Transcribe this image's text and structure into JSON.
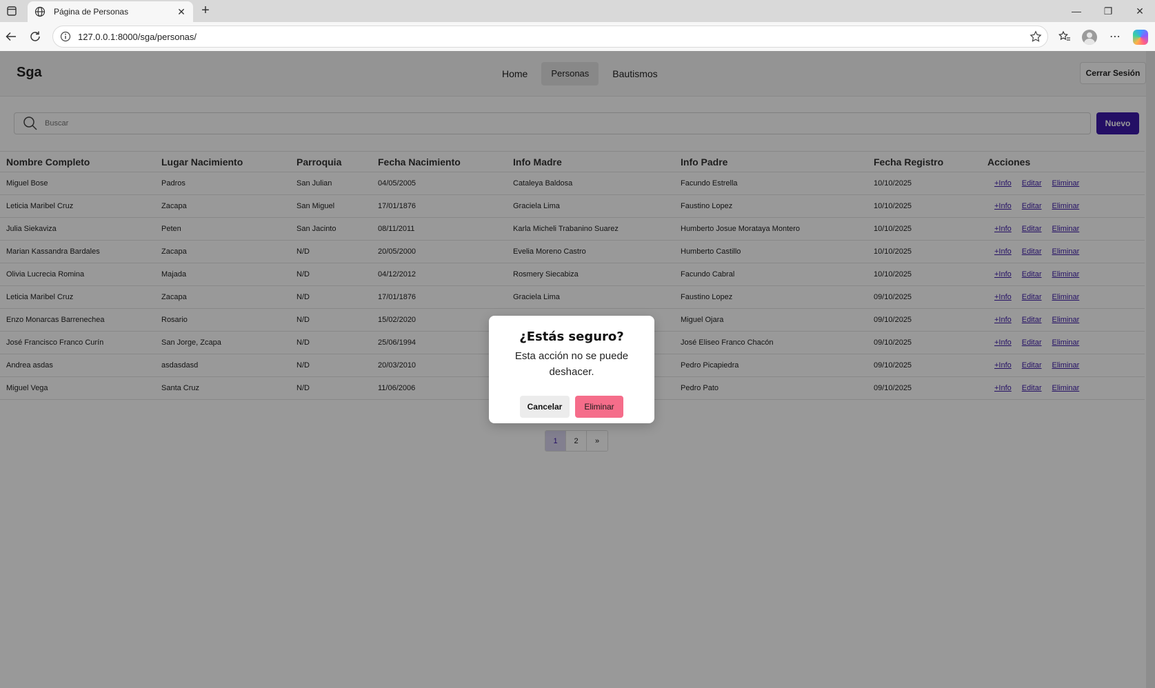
{
  "browser": {
    "tab_title": "Página de Personas",
    "url": "127.0.0.1:8000/sga/personas/"
  },
  "nav": {
    "brand": "Sga",
    "links": [
      "Home",
      "Personas",
      "Bautismos"
    ],
    "active": "Personas",
    "logout": "Cerrar Sesión"
  },
  "search": {
    "placeholder": "Buscar"
  },
  "new_button": "Nuevo",
  "table": {
    "headers": [
      "Nombre Completo",
      "Lugar Nacimiento",
      "Parroquia",
      "Fecha Nacimiento",
      "Info Madre",
      "Info Padre",
      "Fecha Registro",
      "Acciones"
    ],
    "action_labels": [
      "+Info",
      "Editar",
      "Eliminar"
    ],
    "rows": [
      [
        "Miguel Bose",
        "Padros",
        "San Julian",
        "04/05/2005",
        "Cataleya Baldosa",
        "Facundo Estrella",
        "10/10/2025"
      ],
      [
        "Leticia Maribel Cruz",
        "Zacapa",
        "San Miguel",
        "17/01/1876",
        "Graciela Lima",
        "Faustino Lopez",
        "10/10/2025"
      ],
      [
        "Julia Siekaviza",
        "Peten",
        "San Jacinto",
        "08/11/2011",
        "Karla Micheli Trabanino Suarez",
        "Humberto Josue Morataya Montero",
        "10/10/2025"
      ],
      [
        "Marian Kassandra Bardales",
        "Zacapa",
        "N/D",
        "20/05/2000",
        "Evelia Moreno Castro",
        "Humberto Castillo",
        "10/10/2025"
      ],
      [
        "Olivia Lucrecia Romina",
        "Majada",
        "N/D",
        "04/12/2012",
        "Rosmery Siecabiza",
        "Facundo Cabral",
        "10/10/2025"
      ],
      [
        "Leticia Maribel Cruz",
        "Zacapa",
        "N/D",
        "17/01/1876",
        "Graciela Lima",
        "Faustino Lopez",
        "09/10/2025"
      ],
      [
        "Enzo Monarcas Barrenechea",
        "Rosario",
        "N/D",
        "15/02/2020",
        "",
        "Miguel Ojara",
        "09/10/2025"
      ],
      [
        "José Francisco Franco Curín",
        "San Jorge, Zcapa",
        "N/D",
        "25/06/1994",
        "",
        "José Eliseo Franco Chacón",
        "09/10/2025"
      ],
      [
        "Andrea asdas",
        "asdasdasd",
        "N/D",
        "20/03/2010",
        "",
        "Pedro Picapiedra",
        "09/10/2025"
      ],
      [
        "Miguel Vega",
        "Santa Cruz",
        "N/D",
        "11/06/2006",
        "",
        "Pedro Pato",
        "09/10/2025"
      ]
    ]
  },
  "pagination": {
    "pages": [
      "1",
      "2",
      "»"
    ],
    "current": "1"
  },
  "modal": {
    "title": "¿Estás seguro?",
    "message": "Esta acción no se puede deshacer.",
    "cancel": "Cancelar",
    "confirm": "Eliminar"
  },
  "colors": {
    "primary": "#3d1aa8",
    "danger": "#f56d8a"
  }
}
